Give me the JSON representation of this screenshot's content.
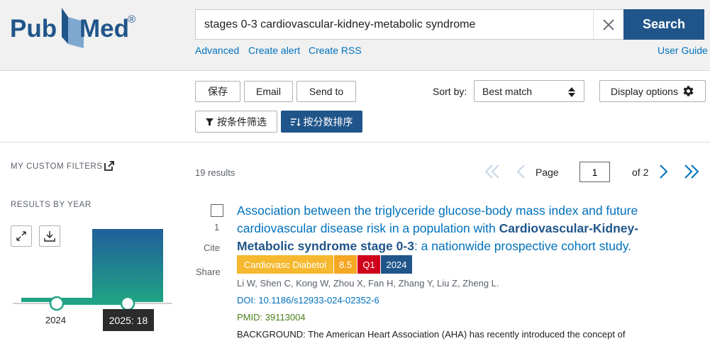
{
  "header": {
    "logo_text": "PubMed",
    "logo_registered": "®",
    "search_value": "stages 0-3 cardiovascular-kidney-metabolic syndrome",
    "search_button": "Search",
    "links": {
      "advanced": "Advanced",
      "create_alert": "Create alert",
      "create_rss": "Create RSS",
      "user_guide": "User Guide"
    }
  },
  "toolbar": {
    "save": "保存",
    "email": "Email",
    "send_to": "Send to",
    "sort_label": "Sort by:",
    "sort_value": "Best match",
    "display_options": "Display options",
    "filter_button": "按条件筛选",
    "score_sort_button": "按分数排序"
  },
  "sidebar": {
    "custom_filters": "MY CUSTOM FILTERS",
    "results_by_year": "RESULTS BY YEAR",
    "year_labels": [
      "2024"
    ],
    "tooltip": "2025: 18",
    "year_counts": [
      {
        "year": "2024",
        "count": 1
      },
      {
        "year": "2025",
        "count": 18
      }
    ]
  },
  "results": {
    "count": "19 results",
    "page_label": "Page",
    "page_value": "1",
    "of_pages": "of 2"
  },
  "article": {
    "number": "1",
    "cite": "Cite",
    "share": "Share",
    "title_part1": "Association between the triglyceride glucose-body mass index and future cardiovascular disease risk in a population with ",
    "title_bold": "Cardiovascular-Kidney-Metabolic syndrome stage 0-3",
    "title_part2": ": a nationwide prospective cohort study.",
    "journal": "Cardiovasc Diabetol",
    "impact": "8.5",
    "quartile": "Q1",
    "year": "2024",
    "authors": "Li W, Shen C, Kong W, Zhou X, Fan H, Zhang Y, Liu Z, Zheng L.",
    "doi": "DOI: 10.1186/s12933-024-02352-6",
    "pmid": "PMID: 39113004",
    "abstract": "BACKGROUND: The American Heart Association (AHA) has recently introduced the concept of"
  },
  "colors": {
    "brand_blue": "#20558a",
    "link_blue": "#0071bc",
    "journal_badge": "#f5b82e",
    "impact_badge": "#f5a623",
    "quartile_badge": "#d0021b",
    "year_badge": "#20558a",
    "pmid_green": "#4b7f1b"
  }
}
